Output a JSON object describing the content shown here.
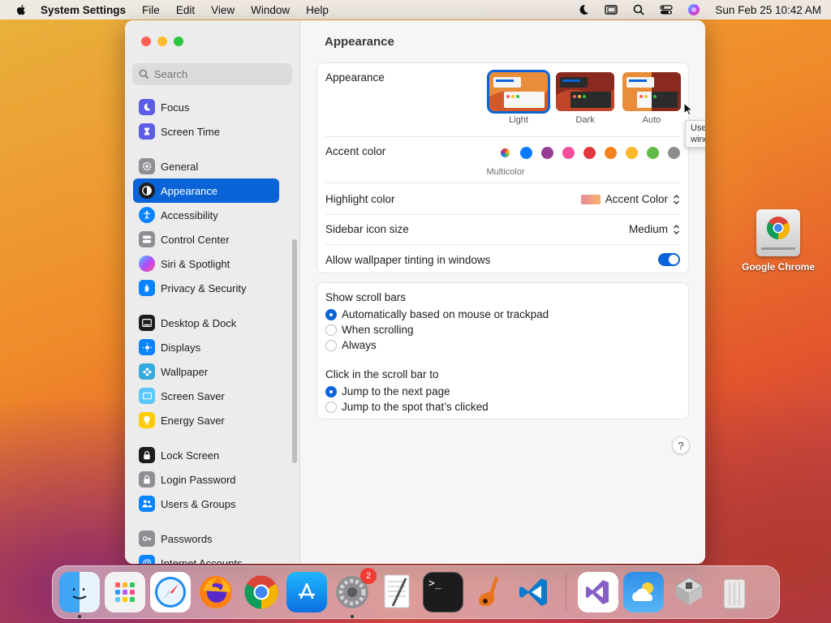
{
  "menubar": {
    "app_name": "System Settings",
    "menus": [
      "File",
      "Edit",
      "View",
      "Window",
      "Help"
    ],
    "clock": "Sun Feb 25  10:42 AM"
  },
  "sidebar": {
    "search_placeholder": "Search",
    "items": [
      {
        "label": "Focus",
        "icon": "moon-icon",
        "color": "#5e5ce6"
      },
      {
        "label": "Screen Time",
        "icon": "hourglass-icon",
        "color": "#5e5ce6"
      },
      {
        "label": "General",
        "icon": "gear-icon",
        "color": "#8e8e93"
      },
      {
        "label": "Appearance",
        "icon": "appearance-icon",
        "color": "#1c1c1e",
        "active": true
      },
      {
        "label": "Accessibility",
        "icon": "accessibility-icon",
        "color": "#0a84ff"
      },
      {
        "label": "Control Center",
        "icon": "control-center-icon",
        "color": "#8e8e93"
      },
      {
        "label": "Siri & Spotlight",
        "icon": "siri-icon",
        "color": "#7a3fe4"
      },
      {
        "label": "Privacy & Security",
        "icon": "hand-icon",
        "color": "#0a84ff"
      },
      {
        "label": "Desktop & Dock",
        "icon": "dock-icon",
        "color": "#1c1c1e"
      },
      {
        "label": "Displays",
        "icon": "sun-icon",
        "color": "#0a84ff"
      },
      {
        "label": "Wallpaper",
        "icon": "flower-icon",
        "color": "#35aadc"
      },
      {
        "label": "Screen Saver",
        "icon": "screen-saver-icon",
        "color": "#5ac8fa"
      },
      {
        "label": "Energy Saver",
        "icon": "bulb-icon",
        "color": "#ffcc00"
      },
      {
        "label": "Lock Screen",
        "icon": "lock-icon",
        "color": "#1c1c1e"
      },
      {
        "label": "Login Password",
        "icon": "key-icon",
        "color": "#8e8e93"
      },
      {
        "label": "Users & Groups",
        "icon": "users-icon",
        "color": "#0a84ff"
      },
      {
        "label": "Passwords",
        "icon": "key-icon",
        "color": "#8e8e93"
      },
      {
        "label": "Internet Accounts",
        "icon": "at-icon",
        "color": "#0a84ff"
      }
    ]
  },
  "content": {
    "title": "Appearance",
    "appearance": {
      "label": "Appearance",
      "options": [
        {
          "label": "Light",
          "selected": true
        },
        {
          "label": "Dark",
          "selected": false
        },
        {
          "label": "Auto",
          "selected": false
        }
      ],
      "tooltip": "Use a light appearance for buttons, menus, and windows."
    },
    "accent": {
      "label": "Accent color",
      "colors": [
        "multicolor",
        "#0a7aff",
        "#953d96",
        "#f74f9e",
        "#e0383e",
        "#f7821b",
        "#fcb827",
        "#62ba46",
        "#8c8c8c"
      ],
      "selected_name": "Multicolor"
    },
    "highlight": {
      "label": "Highlight color",
      "value": "Accent Color"
    },
    "sidebar_icon_size": {
      "label": "Sidebar icon size",
      "value": "Medium"
    },
    "wallpaper_tinting": {
      "label": "Allow wallpaper tinting in windows",
      "on": true
    },
    "scroll_bars": {
      "label": "Show scroll bars",
      "options": [
        {
          "label": "Automatically based on mouse or trackpad",
          "selected": true
        },
        {
          "label": "When scrolling",
          "selected": false
        },
        {
          "label": "Always",
          "selected": false
        }
      ]
    },
    "click_scroll": {
      "label": "Click in the scroll bar to",
      "options": [
        {
          "label": "Jump to the next page",
          "selected": true
        },
        {
          "label": "Jump to the spot that’s clicked",
          "selected": false
        }
      ]
    },
    "help": "?"
  },
  "desktop": {
    "icon_label": "Google Chrome"
  },
  "dock": {
    "settings_badge": "2",
    "apps": [
      "finder-icon",
      "launchpad-icon",
      "safari-icon",
      "firefox-icon",
      "chrome-icon",
      "app-store-icon",
      "system-settings-icon",
      "textedit-icon",
      "terminal-icon",
      "garageband-icon",
      "vscode-icon",
      "visual-studio-icon",
      "weather-icon",
      "boot-camp-icon",
      "trash-icon"
    ]
  }
}
